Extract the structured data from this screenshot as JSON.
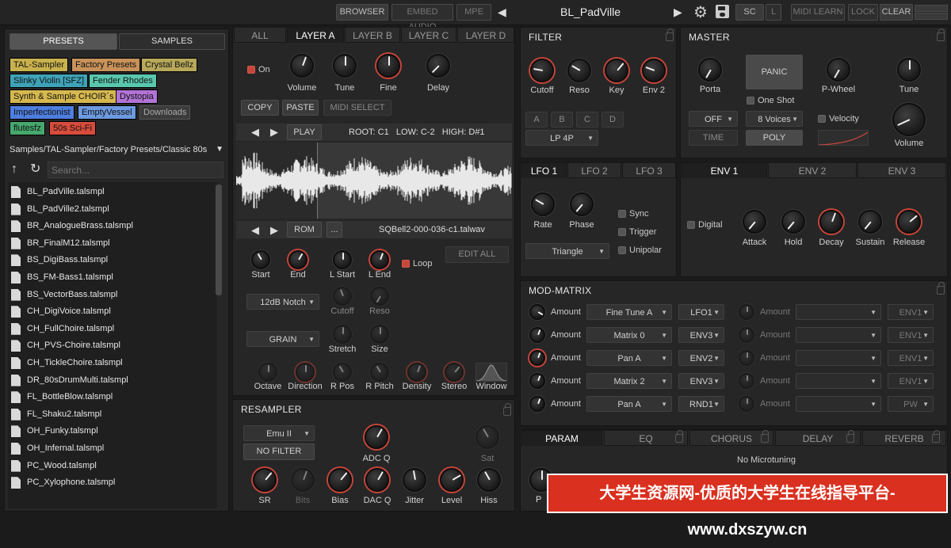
{
  "topbar": {
    "browser": "BROWSER",
    "embed_audio": "EMBED AUDIO",
    "mpe": "MPE",
    "preset_name": "BL_PadVille",
    "sc": "SC",
    "l": "L",
    "midi_learn": "MIDI LEARN",
    "lock": "LOCK",
    "clear": "CLEAR"
  },
  "browser": {
    "tab_presets": "PRESETS",
    "tab_samples": "SAMPLES",
    "tags": [
      "TAL-Sampler",
      "Factory Presets",
      "Crystal Bellz",
      "Slinky Violin [SFZ]",
      "Fender Rhodes",
      "Synth & Sample CHOIR´s",
      "Dystopia",
      "Imperfectionist",
      "EmptyVessel",
      "Downloads",
      "flutesfz",
      "50s Sci-Fi"
    ],
    "path": "Samples/TAL-Sampler/Factory Presets/Classic 80s",
    "search_placeholder": "Search...",
    "files": [
      "BL_PadVille.talsmpl",
      "BL_PadVille2.talsmpl",
      "BR_AnalogueBrass.talsmpl",
      "BR_FinalM12.talsmpl",
      "BS_DigiBass.talsmpl",
      "BS_FM-Bass1.talsmpl",
      "BS_VectorBass.talsmpl",
      "CH_DigiVoice.talsmpl",
      "CH_FullChoire.talsmpl",
      "CH_PVS-Choire.talsmpl",
      "CH_TickleChoire.talsmpl",
      "DR_80sDrumMulti.talsmpl",
      "FL_BottleBlow.talsmpl",
      "FL_Shaku2.talsmpl",
      "OH_Funky.talsmpl",
      "OH_Infernal.talsmpl",
      "PC_Wood.talsmpl",
      "PC_Xylophone.talsmpl"
    ]
  },
  "layers": {
    "tabs": [
      "ALL",
      "LAYER A",
      "LAYER B",
      "LAYER C",
      "LAYER D"
    ],
    "on": "On",
    "volume": "Volume",
    "tune": "Tune",
    "fine": "Fine",
    "delay": "Delay",
    "copy": "COPY",
    "paste": "PASTE",
    "midi_select": "MIDI SELECT",
    "play": "PLAY",
    "sample_info": "ROOT: C1   LOW: C-2   HIGH: D#1",
    "rom": "ROM",
    "dots": "...",
    "sample_file": "SQBell2-000-036-c1.talwav",
    "start": "Start",
    "end": "End",
    "lstart": "L Start",
    "lend": "L End",
    "loop": "Loop",
    "edit_all": "EDIT ALL",
    "filter_type": "12dB Notch",
    "cutoff": "Cutoff",
    "reso": "Reso",
    "grain": "GRAIN",
    "stretch": "Stretch",
    "size": "Size",
    "octave": "Octave",
    "direction": "Direction",
    "rpos": "R Pos",
    "rpitch": "R Pitch",
    "density": "Density",
    "stereo": "Stereo",
    "window": "Window"
  },
  "resampler": {
    "title": "RESAMPLER",
    "model": "Emu II",
    "no_filter": "NO FILTER",
    "adcq": "ADC Q",
    "sat": "Sat",
    "sr": "SR",
    "bits": "Bits",
    "bias": "Bias",
    "dacq": "DAC Q",
    "jitter": "Jitter",
    "level": "Level",
    "hiss": "Hiss"
  },
  "filter": {
    "title": "FILTER",
    "cutoff": "Cutoff",
    "reso": "Reso",
    "key": "Key",
    "env2": "Env 2",
    "modes": [
      "A",
      "B",
      "C",
      "D"
    ],
    "type": "LP 4P"
  },
  "master": {
    "title": "MASTER",
    "porta": "Porta",
    "panic": "PANIC",
    "pwheel": "P-Wheel",
    "tune": "Tune",
    "one_shot": "One Shot",
    "off": "OFF",
    "voices": "8 Voices",
    "velocity": "Velocity",
    "time": "TIME",
    "poly": "POLY",
    "volume": "Volume"
  },
  "lfo": {
    "tabs": [
      "LFO 1",
      "LFO 2",
      "LFO 3"
    ],
    "rate": "Rate",
    "phase": "Phase",
    "sync": "Sync",
    "trigger": "Trigger",
    "unipolar": "Unipolar",
    "wave": "Triangle"
  },
  "env": {
    "tabs": [
      "ENV 1",
      "ENV 2",
      "ENV 3"
    ],
    "digital": "Digital",
    "attack": "Attack",
    "hold": "Hold",
    "decay": "Decay",
    "sustain": "Sustain",
    "release": "Release"
  },
  "modmatrix": {
    "title": "MOD-MATRIX",
    "amount": "Amount",
    "rows": [
      {
        "target": "Fine Tune A",
        "source": "LFO1",
        "right_source": "ENV1"
      },
      {
        "target": "Matrix 0",
        "source": "ENV3",
        "right_source": "ENV1"
      },
      {
        "target": "Pan A",
        "source": "ENV2",
        "right_source": "ENV1"
      },
      {
        "target": "Matrix 2",
        "source": "ENV3",
        "right_source": "ENV1"
      },
      {
        "target": "Pan A",
        "source": "RND1",
        "right_source": "PW"
      }
    ]
  },
  "bottom": {
    "tabs": [
      "PARAM",
      "EQ",
      "CHORUS",
      "DELAY",
      "REVERB"
    ],
    "microtuning": "No Microtuning",
    "p_label": "P"
  },
  "banner": "大学生资源网-优质的大学生在线指导平台-www.dxszyw.cn",
  "watermark": "www.dxszyw.cn"
}
